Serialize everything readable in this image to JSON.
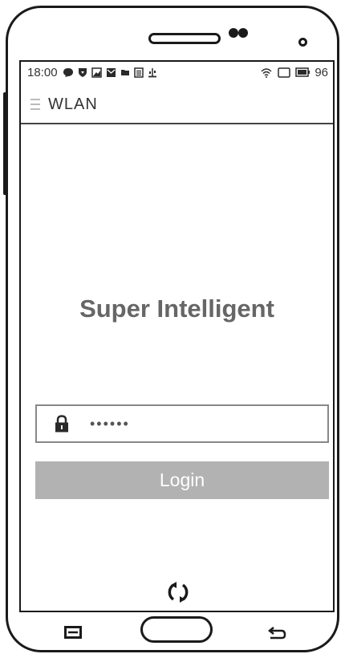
{
  "status_bar": {
    "time": "18:00",
    "battery": "96",
    "icons": [
      "chat-icon",
      "shield-icon",
      "image-icon",
      "mail-icon",
      "folder-icon",
      "document-icon",
      "usb-icon"
    ],
    "right_icons": [
      "wifi-icon",
      "screen-icon",
      "battery-icon"
    ]
  },
  "app_bar": {
    "title": "WLAN",
    "menu_icon": "hamburger-icon"
  },
  "main": {
    "brand": "Super Intelligent",
    "password": {
      "icon": "lock-icon",
      "value": "••••••"
    },
    "login_label": "Login",
    "refresh_icon": "refresh-icon"
  },
  "nav_bar": {
    "menu_icon": "menu-icon",
    "home": "home-button",
    "back_icon": "back-icon"
  },
  "colors": {
    "login_button": "#b2b2b2",
    "brand_text": "#666666",
    "frame": "#1a1a1a"
  }
}
